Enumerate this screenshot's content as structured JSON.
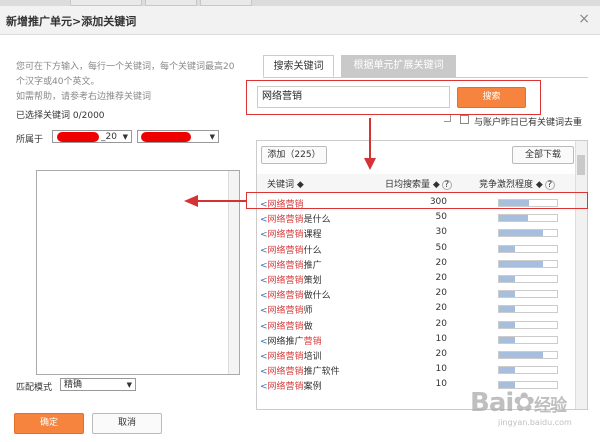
{
  "dialog": {
    "title": "新增推广单元>添加关键词",
    "close_glyph": "×"
  },
  "left": {
    "hint_lines": [
      "您可在下方输入，每行一个关键词，每个关键词最高20",
      "个汉字或40个英文。",
      "如需帮助，请参考右边推荐关键词"
    ],
    "selected_label": "已选择关键词 0/2000",
    "belongs_label": "所属于",
    "unit_select_suffix": "_20",
    "match_label": "匹配模式",
    "match_value": "精确",
    "confirm_label": "确定",
    "cancel_label": "取消"
  },
  "right": {
    "tabs": [
      {
        "label": "搜索关键词",
        "active": true
      },
      {
        "label": "根据单元扩展关键词",
        "active": false
      }
    ],
    "search_value": "网络营销",
    "search_button": "搜索",
    "dedupe_label": "与账户昨日已有关键词去重",
    "add_label": "添加（225）",
    "download_label": "全部下载",
    "columns": {
      "keyword": "关键词 ◆",
      "volume": "日均搜索量 ◆",
      "competition": "竞争激烈程度 ◆"
    },
    "rows": [
      {
        "kw_hl": "网络营销",
        "kw_rest": "",
        "volume": "300",
        "competition": 0.52
      },
      {
        "kw_hl": "网络营销",
        "kw_rest": "是什么",
        "volume": "50",
        "competition": 0.5
      },
      {
        "kw_hl": "网络营销",
        "kw_rest": "课程",
        "volume": "30",
        "competition": 0.75
      },
      {
        "kw_hl": "网络营销",
        "kw_rest": "什么",
        "volume": "50",
        "competition": 0.27
      },
      {
        "kw_hl": "网络营销",
        "kw_rest": "推广",
        "volume": "20",
        "competition": 0.75
      },
      {
        "kw_hl": "网络营销",
        "kw_rest": "策划",
        "volume": "20",
        "competition": 0.27
      },
      {
        "kw_hl": "网络营销",
        "kw_rest": "做什么",
        "volume": "20",
        "competition": 0.27
      },
      {
        "kw_hl": "网络营销",
        "kw_rest": "师",
        "volume": "20",
        "competition": 0.27
      },
      {
        "kw_hl": "网络营销",
        "kw_rest": "做",
        "volume": "20",
        "competition": 0.27
      },
      {
        "kw_pre": "网络推广",
        "kw_hl": "营销",
        "kw_rest": "",
        "volume": "10",
        "competition": 0.27
      },
      {
        "kw_hl": "网络营销",
        "kw_rest": "培训",
        "volume": "20",
        "competition": 0.75
      },
      {
        "kw_hl": "网络营销",
        "kw_rest": "推广软件",
        "volume": "10",
        "competition": 0.27
      },
      {
        "kw_hl": "网络营销",
        "kw_rest": "案例",
        "volume": "10",
        "competition": 0.27
      }
    ]
  },
  "watermark": {
    "brand": "Bai",
    "brand2": "经验",
    "sub": "jingyan.baidu.com"
  },
  "colors": {
    "accent": "#f6843e",
    "keyword_highlight": "#d63d3d",
    "annotation_red": "#d33333",
    "bar_fill": "#a8bedd"
  }
}
